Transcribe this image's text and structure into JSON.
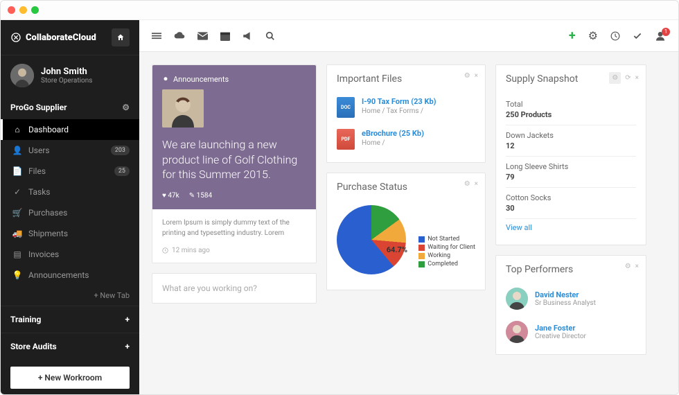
{
  "brand": {
    "name": "CollaborateCloud"
  },
  "user": {
    "name": "John Smith",
    "role": "Store Operations"
  },
  "workspace": {
    "name": "ProGo Supplier"
  },
  "nav": [
    {
      "icon": "home",
      "label": "Dashboard",
      "active": true
    },
    {
      "icon": "user",
      "label": "Users",
      "badge": "203"
    },
    {
      "icon": "file",
      "label": "Files",
      "badge": "25"
    },
    {
      "icon": "check",
      "label": "Tasks"
    },
    {
      "icon": "cart",
      "label": "Purchases"
    },
    {
      "icon": "truck",
      "label": "Shipments"
    },
    {
      "icon": "invoice",
      "label": "Invoices"
    },
    {
      "icon": "bulb",
      "label": "Announcements"
    }
  ],
  "newtab": "+   New Tab",
  "sections": [
    {
      "label": "Training"
    },
    {
      "label": "Store Audits"
    }
  ],
  "newroom": "+  New Workroom",
  "announcement": {
    "heading": "Announcements",
    "text": "We are launching a new product line of Golf Clothing for this Summer 2015.",
    "likes": "47k",
    "comments": "1584",
    "desc": "Lorem Ipsum is simply dummy text of the printing and typesetting industry. Lorem",
    "time": "12 mins ago"
  },
  "status_input": {
    "placeholder": "What are you working on?"
  },
  "files": {
    "title": "Important Files",
    "items": [
      {
        "type": "doc",
        "name": "I-90 Tax Form (23 Kb)",
        "path": "Home / Tax Forms /"
      },
      {
        "type": "pdf",
        "name": "eBrochure (25 Kb)",
        "path": "Home /"
      }
    ]
  },
  "purchase": {
    "title": "Purchase Status",
    "pct": "64.7%",
    "legend": [
      {
        "label": "Not Started",
        "color": "#2a5fd0"
      },
      {
        "label": "Waiting for Client",
        "color": "#d94433"
      },
      {
        "label": "Working",
        "color": "#f2a93b"
      },
      {
        "label": "Completed",
        "color": "#2e9e3f"
      }
    ]
  },
  "snapshot": {
    "title": "Supply Snapshot",
    "rows": [
      {
        "label": "Total",
        "value": "250 Products"
      },
      {
        "label": "Down Jackets",
        "value": "12"
      },
      {
        "label": "Long Sleeve Shirts",
        "value": "79"
      },
      {
        "label": "Cotton Socks",
        "value": "30"
      }
    ],
    "viewall": "View all"
  },
  "performers": {
    "title": "Top Performers",
    "items": [
      {
        "name": "David Nester",
        "role": "Sr Business Analyst"
      },
      {
        "name": "Jane Foster",
        "role": "Creative Director"
      }
    ]
  },
  "notif_count": "1"
}
